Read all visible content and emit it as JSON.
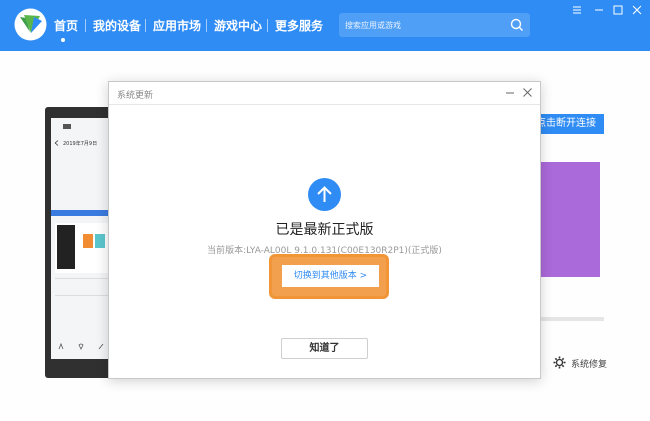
{
  "nav": {
    "items": [
      {
        "label": "首页",
        "active": true
      },
      {
        "label": "我的设备"
      },
      {
        "label": "应用市场"
      },
      {
        "label": "游戏中心"
      },
      {
        "label": "更多服务"
      }
    ]
  },
  "search": {
    "placeholder": "搜索应用或游戏",
    "icon": "search-icon"
  },
  "window_controls": [
    "menu-icon",
    "minimize-icon",
    "maximize-icon",
    "close-icon"
  ],
  "device": {
    "screen_date": "2019年7月9日",
    "disconnect_label": "点击断开连接"
  },
  "bottom_right": {
    "repair_label": "系统修复"
  },
  "dialog": {
    "title": "系统更新",
    "status": "已是最新正式版",
    "version": "当前版本:LYA-AL00L 9.1.0.131(C00E130R2P1)(正式版)",
    "switch_label": "切换到其他版本 >",
    "ok_label": "知道了"
  },
  "colors": {
    "accent": "#2f8cf4",
    "highlight": "#f29537",
    "purple": "#aa6ad9"
  }
}
